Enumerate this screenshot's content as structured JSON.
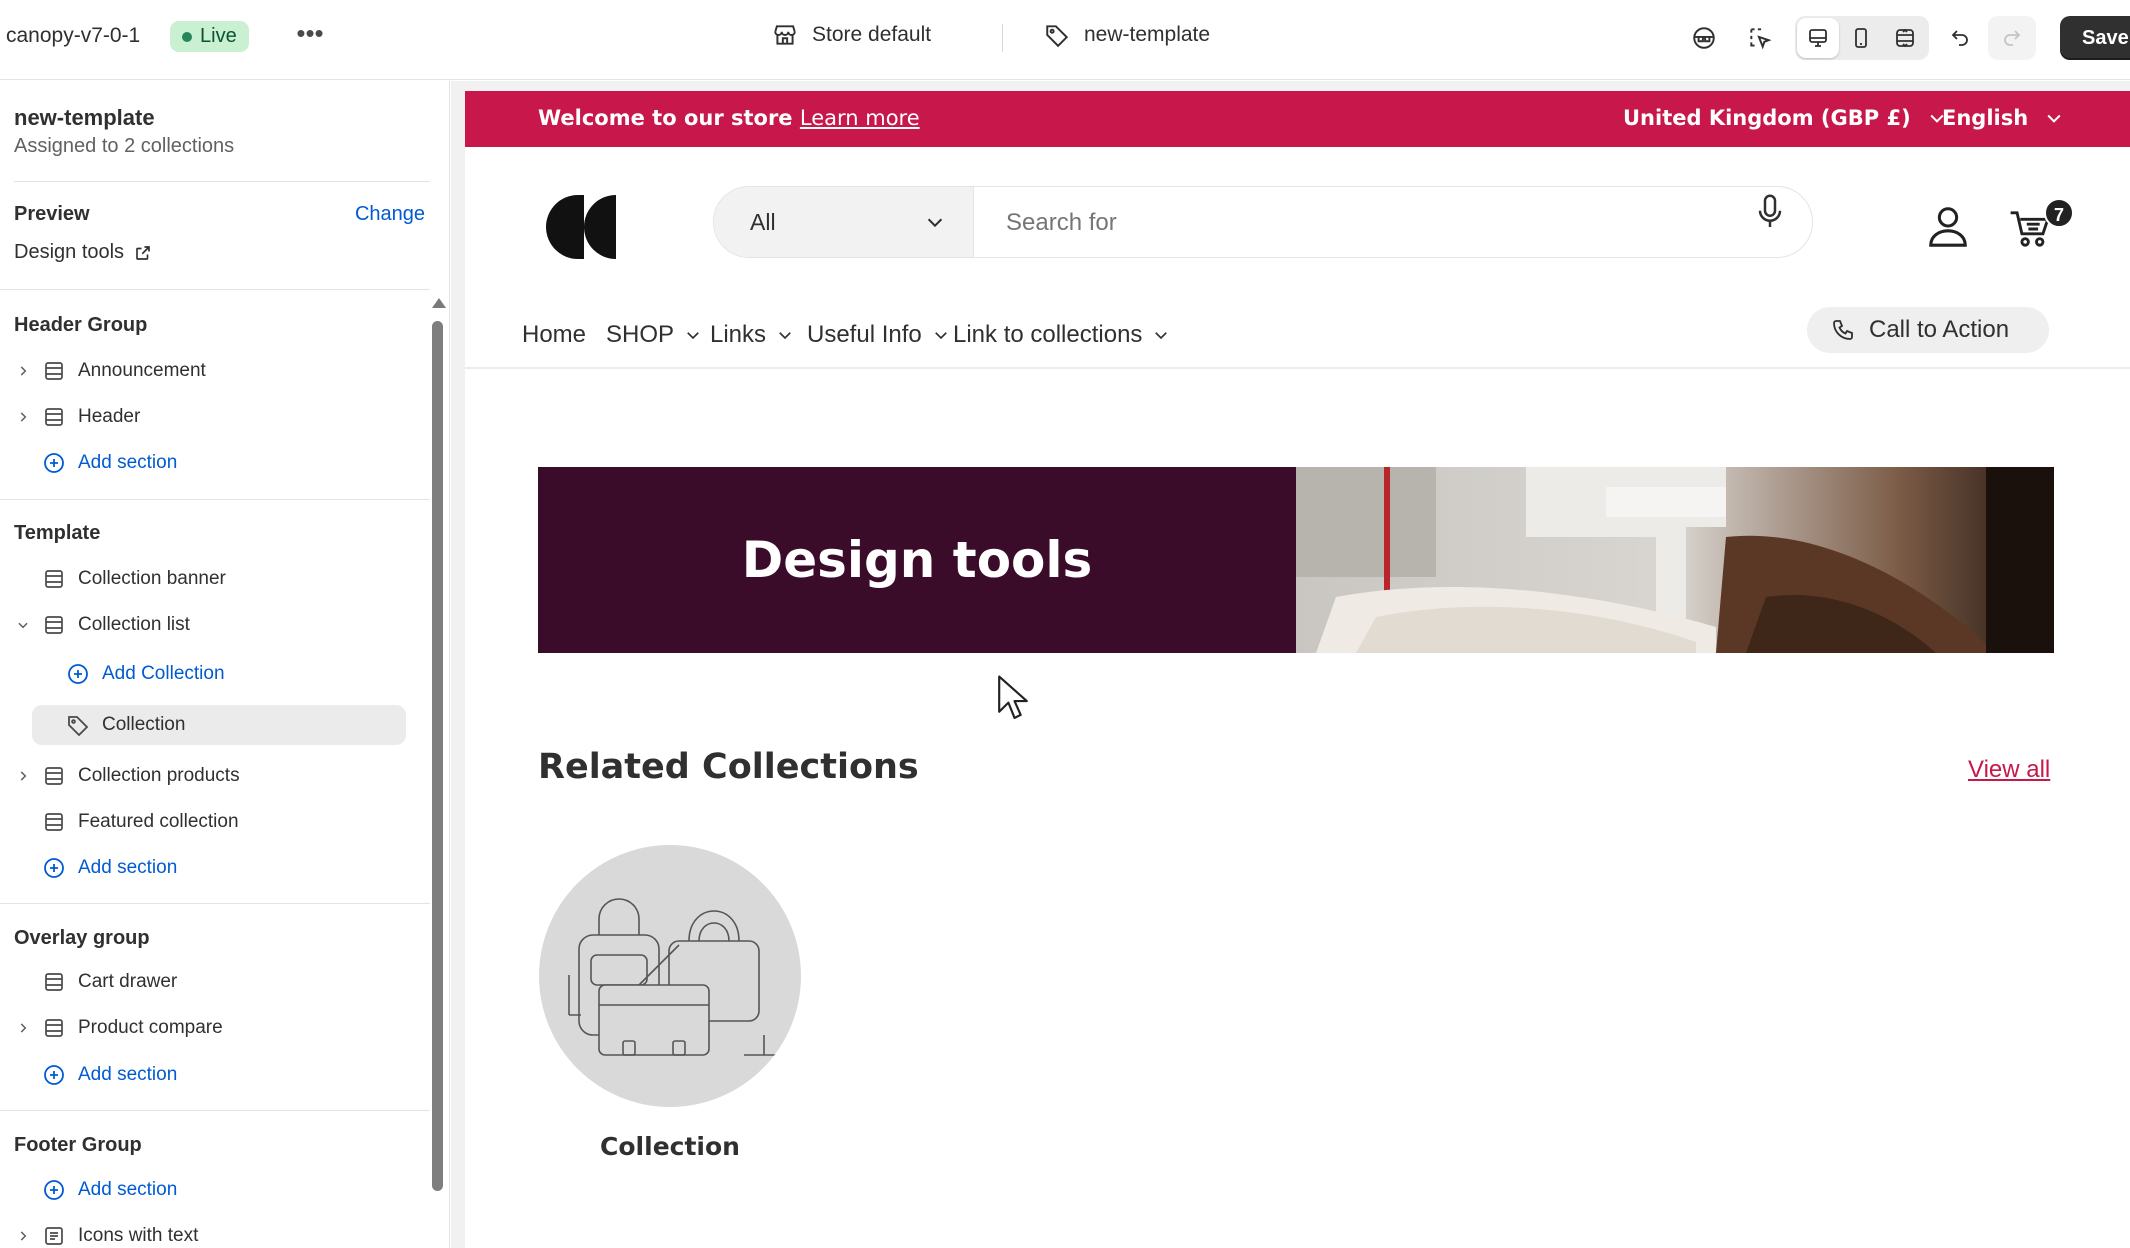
{
  "topbar": {
    "theme_name": "canopy-v7-0-1",
    "live_badge": "Live",
    "more_label": "•••",
    "store_label": "Store default",
    "template_label": "new-template",
    "save_label": "Save",
    "icons": [
      "inspector-icon",
      "select-element-icon",
      "desktop-view-icon",
      "mobile-view-icon",
      "fullscreen-icon",
      "undo-icon",
      "redo-icon"
    ]
  },
  "sidebar": {
    "template_title": "new-template",
    "template_sub": "Assigned to 2 collections",
    "preview_label": "Preview",
    "preview_change": "Change",
    "preview_value": "Design tools",
    "groups": {
      "header": {
        "title": "Header Group",
        "items": [
          {
            "label": "Announcement",
            "expandable": true
          },
          {
            "label": "Header",
            "expandable": true
          }
        ],
        "add": "Add section"
      },
      "template": {
        "title": "Template",
        "items": [
          {
            "label": "Collection banner",
            "expandable": false
          },
          {
            "label": "Collection list",
            "expanded": true
          },
          {
            "label": "Add Collection"
          },
          {
            "label": "Collection",
            "selected": true
          },
          {
            "label": "Collection products",
            "expandable": true
          },
          {
            "label": "Featured collection",
            "expandable": false
          }
        ],
        "add": "Add section"
      },
      "overlay": {
        "title": "Overlay group",
        "items": [
          {
            "label": "Cart drawer",
            "expandable": false
          },
          {
            "label": "Product compare",
            "expandable": true
          }
        ],
        "add": "Add section"
      },
      "footer": {
        "title": "Footer Group",
        "add": "Add section",
        "items": [
          {
            "label": "Icons with text",
            "expandable": true
          }
        ]
      }
    }
  },
  "store": {
    "announcement": {
      "text": "Welcome to our store",
      "link": "Learn more",
      "country": "United Kingdom (GBP £)",
      "language": "English"
    },
    "search": {
      "category": "All",
      "placeholder": "Search for"
    },
    "cart_count": "7",
    "nav": [
      "Home",
      "SHOP",
      "Links",
      "Useful Info",
      "Link to collections"
    ],
    "cta": "Call to Action",
    "banner_title": "Design tools",
    "related_title": "Related Collections",
    "view_all": "View all",
    "collection_name": "Collection",
    "colors": {
      "brand": "#c8174a",
      "banner_bg": "#3b0b2a",
      "link": "#005bd3"
    }
  }
}
